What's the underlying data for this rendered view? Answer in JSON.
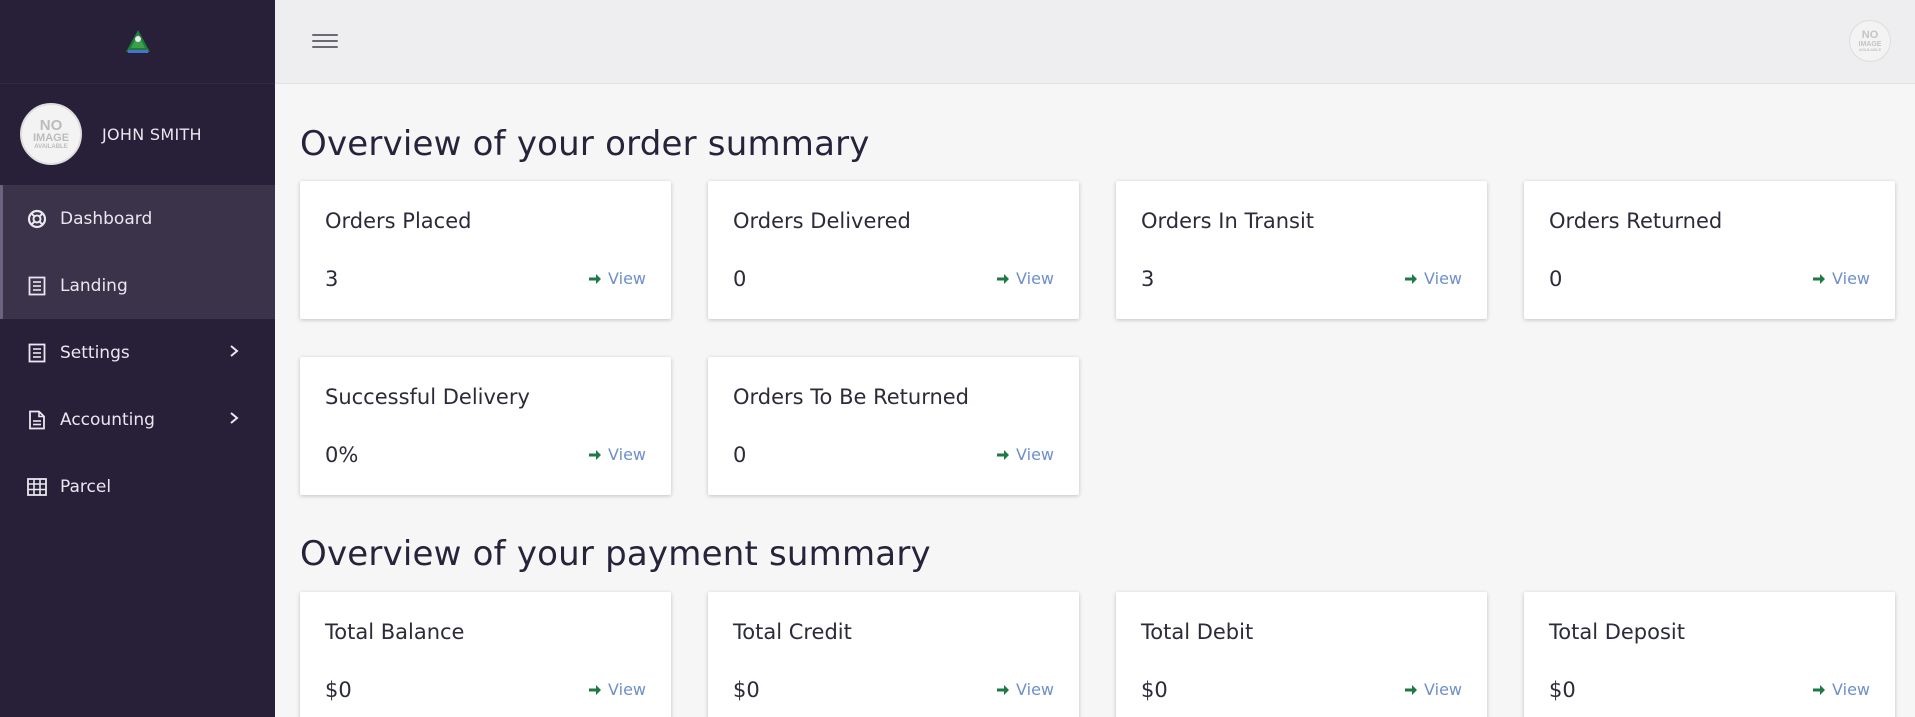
{
  "sidebar": {
    "user_name": "JOHN SMITH",
    "avatar_text": {
      "line1": "NO",
      "line2": "IMAGE",
      "line3": "AVAILABLE"
    },
    "items": [
      {
        "label": "Dashboard",
        "icon": "life-ring-icon"
      },
      {
        "label": "Landing",
        "icon": "document-icon"
      },
      {
        "label": "Settings",
        "icon": "document-icon"
      },
      {
        "label": "Accounting",
        "icon": "file-icon"
      },
      {
        "label": "Parcel",
        "icon": "table-icon"
      }
    ]
  },
  "topbar": {
    "avatar_text": {
      "line1": "NO",
      "line2": "IMAGE",
      "line3": "AVAILABLE"
    }
  },
  "order_summary": {
    "title": "Overview of your order summary",
    "cards": [
      {
        "title": "Orders Placed",
        "value": "3",
        "link": "View"
      },
      {
        "title": "Orders Delivered",
        "value": "0",
        "link": "View"
      },
      {
        "title": "Orders In Transit",
        "value": "3",
        "link": "View"
      },
      {
        "title": "Orders Returned",
        "value": "0",
        "link": "View"
      },
      {
        "title": "Successful Delivery",
        "value": "0%",
        "link": "View"
      },
      {
        "title": "Orders To Be Returned",
        "value": "0",
        "link": "View"
      }
    ]
  },
  "payment_summary": {
    "title": "Overview of your payment summary",
    "cards": [
      {
        "title": "Total Balance",
        "value": "$0",
        "link": "View"
      },
      {
        "title": "Total Credit",
        "value": "$0",
        "link": "View"
      },
      {
        "title": "Total Debit",
        "value": "$0",
        "link": "View"
      },
      {
        "title": "Total Deposit",
        "value": "$0",
        "link": "View"
      }
    ]
  },
  "colors": {
    "sidebar_bg": "#272038",
    "accent_arrow": "#1e7a45",
    "link": "#6e8fcc"
  }
}
